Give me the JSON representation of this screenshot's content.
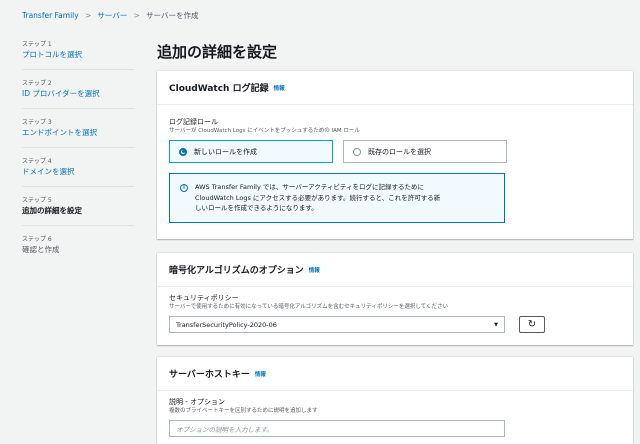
{
  "breadcrumb": {
    "items": [
      "Transfer Family",
      "サーバー",
      "サーバーを作成"
    ],
    "separator": ">"
  },
  "steps": [
    {
      "num": "ステップ 1",
      "title": "プロトコルを選択"
    },
    {
      "num": "ステップ 2",
      "title": "ID プロバイダーを選択"
    },
    {
      "num": "ステップ 3",
      "title": "エンドポイントを選択"
    },
    {
      "num": "ステップ 4",
      "title": "ドメインを選択"
    },
    {
      "num": "ステップ 5",
      "title": "追加の詳細を設定"
    },
    {
      "num": "ステップ 6",
      "title": "確認と作成"
    }
  ],
  "page_title": "追加の詳細を設定",
  "cloudwatch": {
    "title": "CloudWatch ログ記録",
    "info": "情報",
    "role_label": "ログ記録ロール",
    "role_desc": "サーバーが CloudWatch Logs にイベントをプッシュするための IAM ロール",
    "option_new": "新しいロールを作成",
    "option_existing": "既存のロールを選択",
    "alert_icon": "i",
    "alert_line1": "AWS Transfer Family では、サーバーアクティビティをログに記録するために",
    "alert_line2": "CloudWatch Logs にアクセスする必要があります。続行すると、これを許可する新",
    "alert_line3": "しいロールを作成できるようになります。"
  },
  "encryption": {
    "title": "暗号化アルゴリズムのオプション",
    "info": "情報",
    "policy_label": "セキュリティポリシー",
    "policy_desc": "サーバーで使用するために有効になっている暗号化アルゴリズムを含むセキュリティポリシーを選択してください",
    "policy_value": "TransferSecurityPolicy-2020-06",
    "caret_icon": "caret-down-icon",
    "refresh_icon": "refresh-icon"
  },
  "hostkey": {
    "title": "サーバーホストキー",
    "info": "情報",
    "desc_label": "説明 - オプション",
    "desc_help": "複数のプライベートキーを区別するために説明を追加します",
    "desc_placeholder": "オプションの説明を入力します。"
  },
  "colors": {
    "link": "#0073bb",
    "selected_bg": "#f1faff",
    "selected_border": "#00a1c9",
    "page_bg": "#f2f3f3"
  }
}
